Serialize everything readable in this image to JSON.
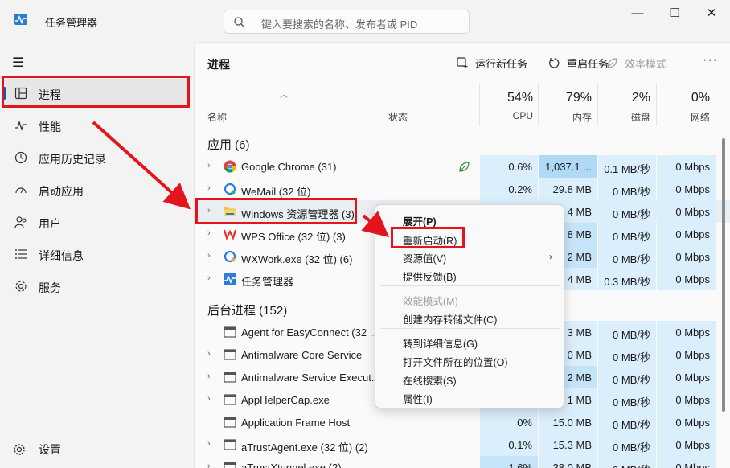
{
  "window": {
    "title": "任务管理器",
    "search_placeholder": "键入要搜索的名称、发布者或 PID",
    "minimize": "—",
    "maximize": "☐",
    "close": "✕"
  },
  "sidebar": {
    "items": [
      {
        "label": "进程",
        "icon": "processes-icon"
      },
      {
        "label": "性能",
        "icon": "performance-icon"
      },
      {
        "label": "应用历史记录",
        "icon": "history-icon"
      },
      {
        "label": "启动应用",
        "icon": "startup-icon"
      },
      {
        "label": "用户",
        "icon": "users-icon"
      },
      {
        "label": "详细信息",
        "icon": "details-icon"
      },
      {
        "label": "服务",
        "icon": "services-icon"
      }
    ],
    "settings": "设置"
  },
  "toolbar": {
    "title": "进程",
    "run_new_task": "运行新任务",
    "restart_task": "重启任务",
    "efficiency_mode": "效率模式",
    "more": "···"
  },
  "columns": {
    "name": "名称",
    "status": "状态",
    "cpu": {
      "pct": "54%",
      "label": "CPU"
    },
    "memory": {
      "pct": "79%",
      "label": "内存"
    },
    "disk": {
      "pct": "2%",
      "label": "磁盘"
    },
    "network": {
      "pct": "0%",
      "label": "网络"
    }
  },
  "groups": {
    "apps": "应用 (6)",
    "background": "后台进程 (152)"
  },
  "apps": [
    {
      "name": "Google Chrome (31)",
      "cpu": "0.6%",
      "mem": "1,037.1 ...",
      "disk": "0.1 MB/秒",
      "net": "0 Mbps",
      "icon": "chrome-icon",
      "status_icon": true
    },
    {
      "name": "WeMail (32 位)",
      "cpu": "0.2%",
      "mem": "29.8 MB",
      "disk": "0 MB/秒",
      "net": "0 Mbps",
      "icon": "wemail-icon"
    },
    {
      "name": "Windows 资源管理器 (3)",
      "cpu": "",
      "mem": "4 MB",
      "disk": "0 MB/秒",
      "net": "0 Mbps",
      "icon": "folder-icon"
    },
    {
      "name": "WPS Office (32 位) (3)",
      "cpu": "",
      "mem": "8 MB",
      "disk": "0 MB/秒",
      "net": "0 Mbps",
      "icon": "wps-icon"
    },
    {
      "name": "WXWork.exe (32 位) (6)",
      "cpu": "",
      "mem": "2 MB",
      "disk": "0 MB/秒",
      "net": "0 Mbps",
      "icon": "wxwork-icon"
    },
    {
      "name": "任务管理器",
      "cpu": "",
      "mem": "4 MB",
      "disk": "0.3 MB/秒",
      "net": "0 Mbps",
      "icon": "taskmgr-icon"
    }
  ],
  "background": [
    {
      "name": "Agent for EasyConnect (32 ...",
      "cpu": "",
      "mem": "3 MB",
      "disk": "0 MB/秒",
      "net": "0 Mbps",
      "chev": false
    },
    {
      "name": "Antimalware Core Service",
      "cpu": "",
      "mem": "0 MB",
      "disk": "0 MB/秒",
      "net": "0 Mbps",
      "chev": true
    },
    {
      "name": "Antimalware Service Execut...",
      "cpu": "",
      "mem": "2 MB",
      "disk": "0 MB/秒",
      "net": "0 Mbps",
      "chev": true
    },
    {
      "name": "AppHelperCap.exe",
      "cpu": "",
      "mem": "1 MB",
      "disk": "0 MB/秒",
      "net": "0 Mbps",
      "chev": true
    },
    {
      "name": "Application Frame Host",
      "cpu": "0%",
      "mem": "15.0 MB",
      "disk": "0 MB/秒",
      "net": "0 Mbps",
      "chev": false
    },
    {
      "name": "aTrustAgent.exe (32 位) (2)",
      "cpu": "0.1%",
      "mem": "15.3 MB",
      "disk": "0 MB/秒",
      "net": "0 Mbps",
      "chev": true
    },
    {
      "name": "aTrustXtunnel.exe (2)",
      "cpu": "1.6%",
      "mem": "38.0 MB",
      "disk": "0 MB/秒",
      "net": "0 Mbps",
      "chev": true
    }
  ],
  "context_menu": {
    "items": [
      "展开(P)",
      "重新启动(R)",
      "资源值(V)",
      "提供反馈(B)",
      "效能模式(M)",
      "创建内存转储文件(C)",
      "转到详细信息(G)",
      "打开文件所在的位置(O)",
      "在线搜索(S)",
      "属性(I)"
    ],
    "submenu_arrow": "›"
  },
  "colors": {
    "accent": "#005fb8",
    "highlight_red": "#e3141c",
    "heat_light": "#dbeefb",
    "heat_mid": "#c6e4f8",
    "heat_strong": "#b0d9f6"
  }
}
